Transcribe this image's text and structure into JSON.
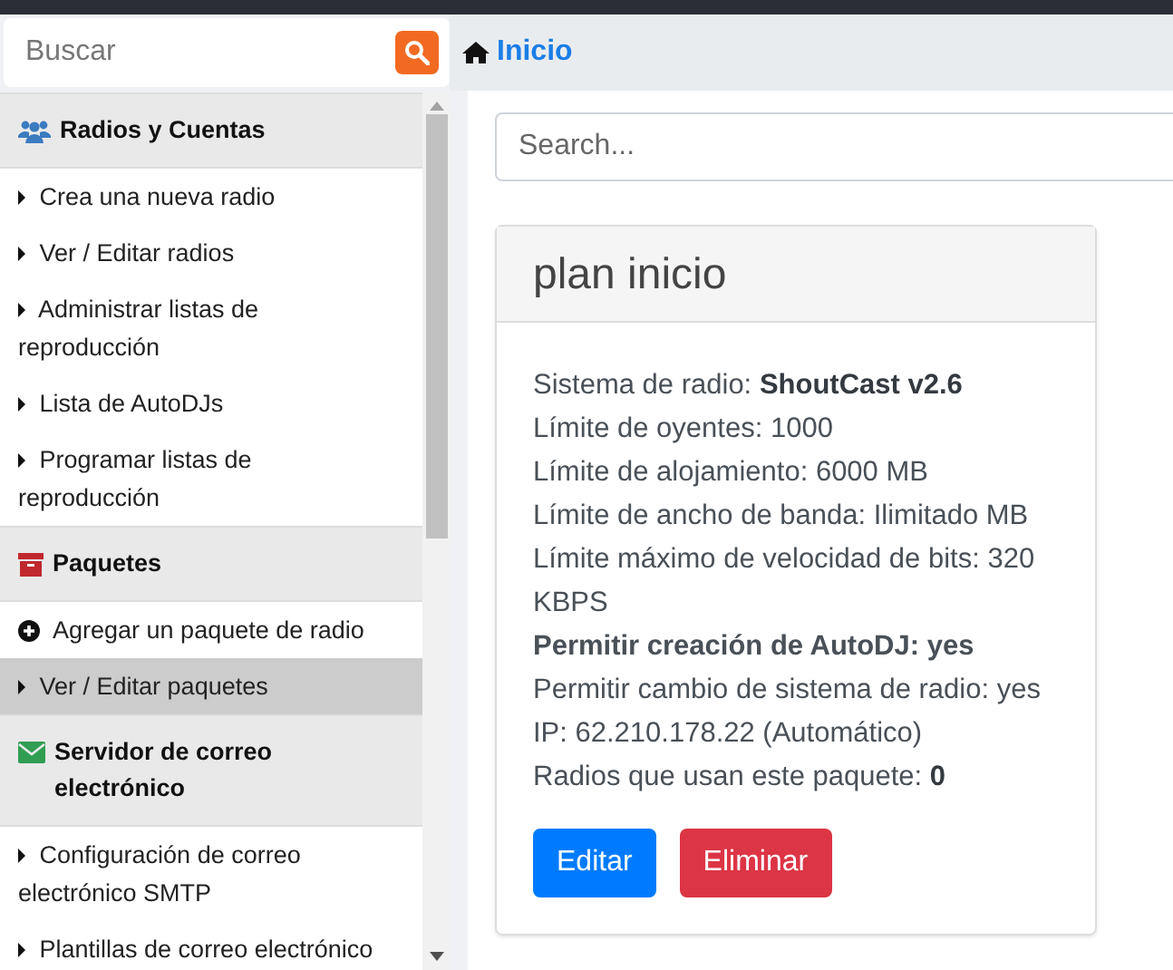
{
  "sidebar": {
    "search": {
      "placeholder": "Buscar"
    },
    "sections": [
      {
        "title": "Radios y Cuentas",
        "kind": "users",
        "items": [
          {
            "label": "Crea una nueva radio",
            "kind": "caret",
            "selected": false
          },
          {
            "label": "Ver / Editar radios",
            "kind": "caret",
            "selected": false
          },
          {
            "label": "Administrar listas de reproducción",
            "kind": "caret",
            "selected": false
          },
          {
            "label": "Lista de AutoDJs",
            "kind": "caret",
            "selected": false
          },
          {
            "label": "Programar listas de reproducción",
            "kind": "caret",
            "selected": false
          }
        ]
      },
      {
        "title": "Paquetes",
        "kind": "archive",
        "items": [
          {
            "label": "Agregar un paquete de radio",
            "kind": "plus",
            "selected": false
          },
          {
            "label": "Ver / Editar paquetes",
            "kind": "caret",
            "selected": true
          }
        ]
      },
      {
        "title": "Servidor de correo electrónico",
        "kind": "envelope",
        "items": [
          {
            "label": "Configuración de correo electrónico SMTP",
            "kind": "caret",
            "selected": false
          },
          {
            "label": "Plantillas de correo electrónico",
            "kind": "caret",
            "selected": false
          }
        ]
      }
    ]
  },
  "breadcrumb": {
    "label": "Inicio"
  },
  "search": {
    "placeholder": "Search..."
  },
  "card": {
    "title": "plan inicio",
    "lines": [
      {
        "text": "Sistema de radio: **ShoutCast v2.6**",
        "bold": false
      },
      {
        "text": "Límite de oyentes: 1000",
        "bold": false
      },
      {
        "text": "Límite de alojamiento: 6000 MB",
        "bold": false
      },
      {
        "text": "Límite de ancho de banda: Ilimitado MB",
        "bold": false
      },
      {
        "text": "Límite máximo de velocidad de bits: 320 KBPS",
        "bold": false
      },
      {
        "text": "Permitir creación de AutoDJ: yes",
        "bold": true
      },
      {
        "text": "Permitir cambio de sistema de radio: yes",
        "bold": false
      },
      {
        "text": "IP: 62.210.178.22 (Automático)",
        "bold": false
      },
      {
        "text": "Radios que usan este paquete: **0**",
        "bold": false
      }
    ],
    "buttons": [
      {
        "label": "Editar",
        "kind": "primary"
      },
      {
        "label": "Eliminar",
        "kind": "danger"
      }
    ]
  }
}
